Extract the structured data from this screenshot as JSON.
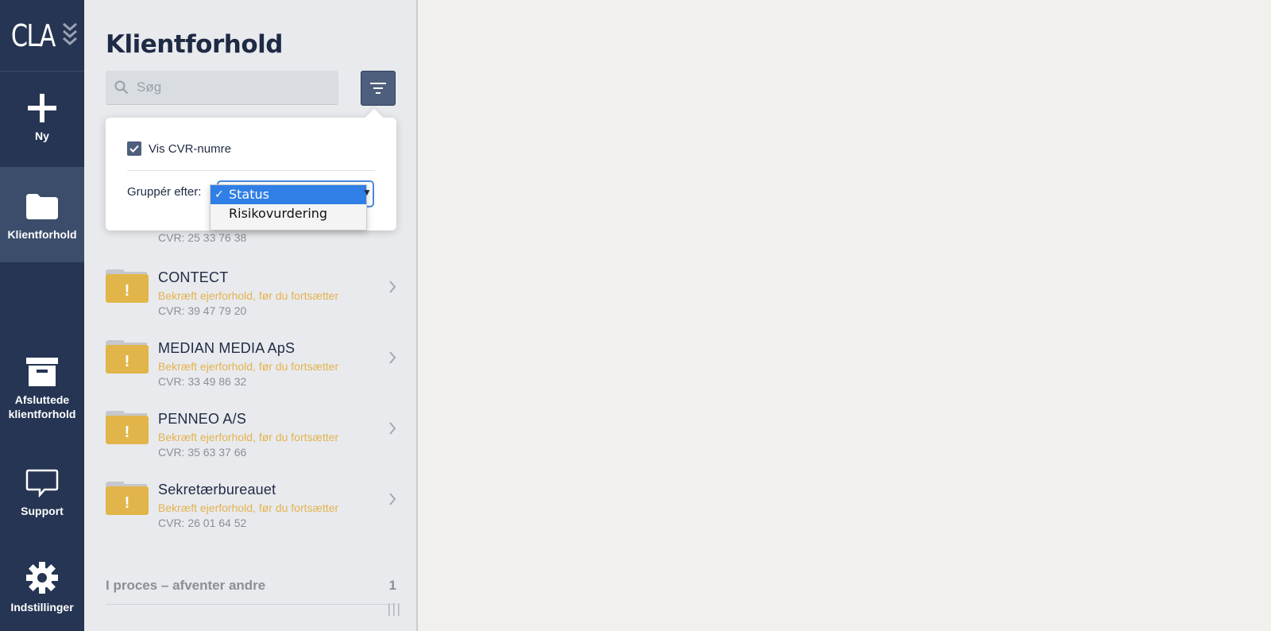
{
  "logo": {
    "text": "CLA"
  },
  "nav": {
    "items": [
      {
        "label": "Ny",
        "icon": "plus-icon"
      },
      {
        "label": "Klientforhold",
        "icon": "folder-icon",
        "active": true
      },
      {
        "label": "Afsluttede klientforhold",
        "icon": "archive-box-icon"
      },
      {
        "label": "Support",
        "icon": "chat-bubble-icon"
      },
      {
        "label": "Indstillinger",
        "icon": "gear-icon"
      }
    ]
  },
  "panel": {
    "title": "Klientforhold",
    "search": {
      "placeholder": "Søg",
      "value": ""
    },
    "filter_popover": {
      "show_cvr_label": "Vis CVR-numre",
      "show_cvr_checked": true,
      "group_by_label": "Gruppér efter:",
      "group_by_options": [
        "Status",
        "Risikovurdering"
      ],
      "group_by_selected": "Status",
      "checkmark": "✓"
    },
    "partial_item_cvr": "CVR: 25 33 76 38",
    "clients": [
      {
        "name": "CONTECT",
        "warning": "Bekræft ejerforhold, før du fortsætter",
        "cvr": "CVR: 39 47 79 20",
        "badge": "!"
      },
      {
        "name": "MEDIAN MEDIA ApS",
        "warning": "Bekræft ejerforhold, før du fortsætter",
        "cvr": "CVR: 33 49 86 32",
        "badge": "!"
      },
      {
        "name": "PENNEO A/S",
        "warning": "Bekræft ejerforhold, før du fortsætter",
        "cvr": "CVR: 35 63 37 66",
        "badge": "!"
      },
      {
        "name": "Sekretærbureauet",
        "warning": "Bekræft ejerforhold, før du fortsætter",
        "cvr": "CVR: 26 01 64 52",
        "badge": "!"
      }
    ],
    "section": {
      "title": "I proces – afventer andre",
      "count": "1"
    }
  },
  "colors": {
    "nav_bg": "#253553",
    "warning": "#e5b34f",
    "folder": "#e2b54a",
    "accent": "#2f7fe6"
  }
}
